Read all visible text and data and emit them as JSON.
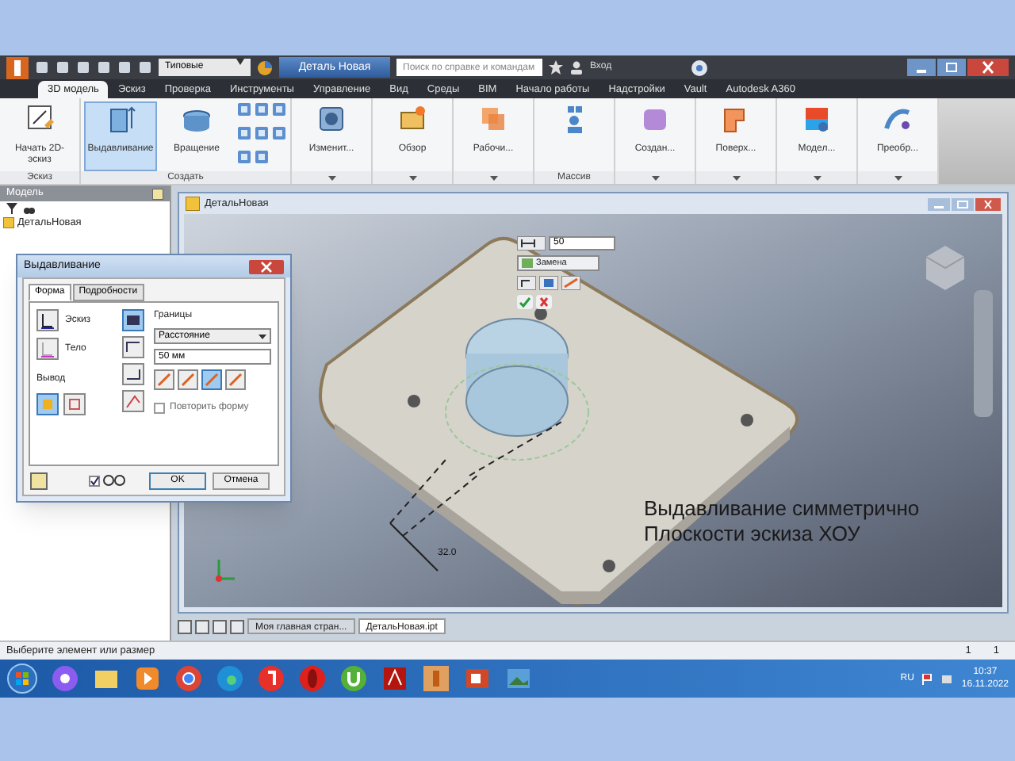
{
  "quick_access": {
    "style_dropdown": "Типовые",
    "document_title": "Деталь Новая",
    "search": {
      "placeholder": "Поиск по справке и командам"
    },
    "user": "Вход"
  },
  "ribbon_tabs": [
    {
      "label": "3D модель",
      "selected": true
    },
    {
      "label": "Эскиз",
      "selected": false
    },
    {
      "label": "Проверка",
      "selected": false
    },
    {
      "label": "Инструменты",
      "selected": false
    },
    {
      "label": "Управление",
      "selected": false
    },
    {
      "label": "Вид",
      "selected": false
    },
    {
      "label": "Среды",
      "selected": false
    },
    {
      "label": "BIM",
      "selected": false
    },
    {
      "label": "Начало работы",
      "selected": false
    },
    {
      "label": "Надстройки",
      "selected": false
    },
    {
      "label": "Vault",
      "selected": false
    },
    {
      "label": "Autodesk A360",
      "selected": false
    }
  ],
  "ribbon_panels": [
    {
      "label": "Эскиз",
      "buttons": [
        {
          "label": "Начать 2D-эскиз",
          "kind": "sketch",
          "selected": false
        }
      ]
    },
    {
      "label": "Создать",
      "buttons": [
        {
          "label": "Выдавливание",
          "kind": "extrude",
          "selected": true
        },
        {
          "label": "Вращение",
          "kind": "revolve",
          "selected": false
        },
        {
          "kind": "grid"
        }
      ]
    },
    {
      "buttons": [
        {
          "label": "Изменит...",
          "kind": "modify",
          "selected": false
        }
      ]
    },
    {
      "buttons": [
        {
          "label": "Обзор",
          "kind": "explore",
          "selected": false
        }
      ]
    },
    {
      "buttons": [
        {
          "label": "Рабочи...",
          "kind": "work",
          "selected": false
        }
      ]
    },
    {
      "label": "Массив",
      "buttons": [
        {
          "kind": "pattern",
          "selected": false
        }
      ]
    },
    {
      "buttons": [
        {
          "label": "Создан...",
          "kind": "create",
          "selected": false
        }
      ]
    },
    {
      "buttons": [
        {
          "label": "Поверх...",
          "kind": "surface",
          "selected": false
        }
      ]
    },
    {
      "buttons": [
        {
          "label": "Модел...",
          "kind": "simulation",
          "selected": false
        }
      ]
    },
    {
      "buttons": [
        {
          "label": "Преобр...",
          "kind": "convert",
          "selected": false
        }
      ]
    }
  ],
  "browser": {
    "title": "Модель",
    "root": "ДетальНовая"
  },
  "document_window": {
    "title": "ДетальНовая"
  },
  "mini_toolbar": {
    "value": "50",
    "output": "Замена"
  },
  "dialog": {
    "title": "Выдавливание",
    "tabs": [
      {
        "label": "Форма",
        "selected": true
      },
      {
        "label": "Подробности",
        "selected": false
      }
    ],
    "profile": "Эскиз",
    "solid": "Тело",
    "output_label": "Вывод",
    "extents_label": "Границы",
    "extents": "Расстояние",
    "distance": "50 мм",
    "directions": [
      {
        "selected": false
      },
      {
        "selected": false
      },
      {
        "selected": true
      },
      {
        "selected": false
      }
    ],
    "repeat": {
      "label": "Повторить форму",
      "checked": false
    },
    "preview": {
      "checked": true
    },
    "buttons": [
      "OK",
      "Отмена"
    ]
  },
  "dimension": "32.0",
  "annotation": [
    "Выдавливание симметрично",
    "Плоскости эскиза ХОУ"
  ],
  "document_tabs": [
    {
      "label": "Моя главная стран...",
      "selected": false
    },
    {
      "label": "ДетальНовая.ipt",
      "selected": true
    }
  ],
  "status_bar": {
    "text": "Выберите элемент или размер",
    "counts": [
      "1",
      "1"
    ]
  },
  "taskbar": {
    "language": "RU",
    "time": "10:37",
    "date": "16.11.2022"
  }
}
